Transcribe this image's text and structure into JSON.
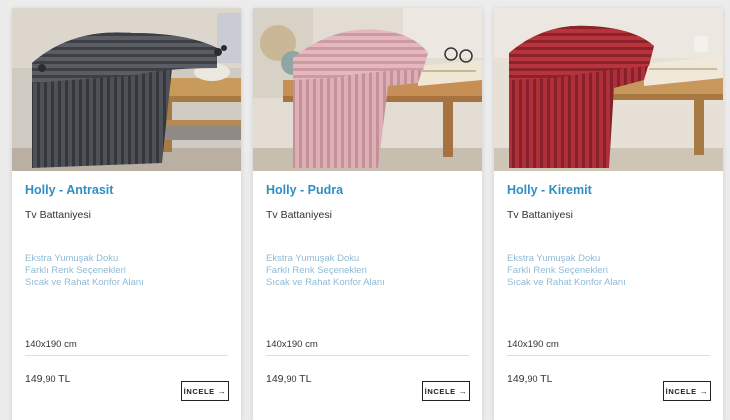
{
  "products": [
    {
      "name": "Holly - Antrasit",
      "category": "Tv Battaniyesi",
      "features": [
        "Ekstra Yumuşak Doku",
        "Farklı Renk Seçenekleri",
        "Sıcak ve Rahat Konfor Alanı"
      ],
      "size": "140x190 cm",
      "price_main": "149,",
      "price_cents": "90",
      "price_currency": " TL",
      "button_label": "İNCELE",
      "button_icon": "arrow-right-icon",
      "color": "#55595f",
      "background": "living-room-wooden-bench"
    },
    {
      "name": "Holly - Pudra",
      "category": "Tv Battaniyesi",
      "features": [
        "Ekstra Yumuşak Doku",
        "Farklı Renk Seçenekleri",
        "Sıcak ve Rahat Konfor Alanı"
      ],
      "size": "140x190 cm",
      "price_main": "149,",
      "price_cents": "90",
      "price_currency": " TL",
      "button_label": "İNCELE",
      "button_icon": "arrow-right-icon",
      "color": "#d9a6ae",
      "background": "wooden-bench-with-book-and-glasses"
    },
    {
      "name": "Holly - Kiremit",
      "category": "Tv Battaniyesi",
      "features": [
        "Ekstra Yumuşak Doku",
        "Farklı Renk Seçenekleri",
        "Sıcak ve Rahat Konfor Alanı"
      ],
      "size": "140x190 cm",
      "price_main": "149,",
      "price_cents": "90",
      "price_currency": " TL",
      "button_label": "İNCELE",
      "button_icon": "arrow-right-icon",
      "color": "#a8262d",
      "background": "wooden-bench-with-open-book"
    }
  ]
}
